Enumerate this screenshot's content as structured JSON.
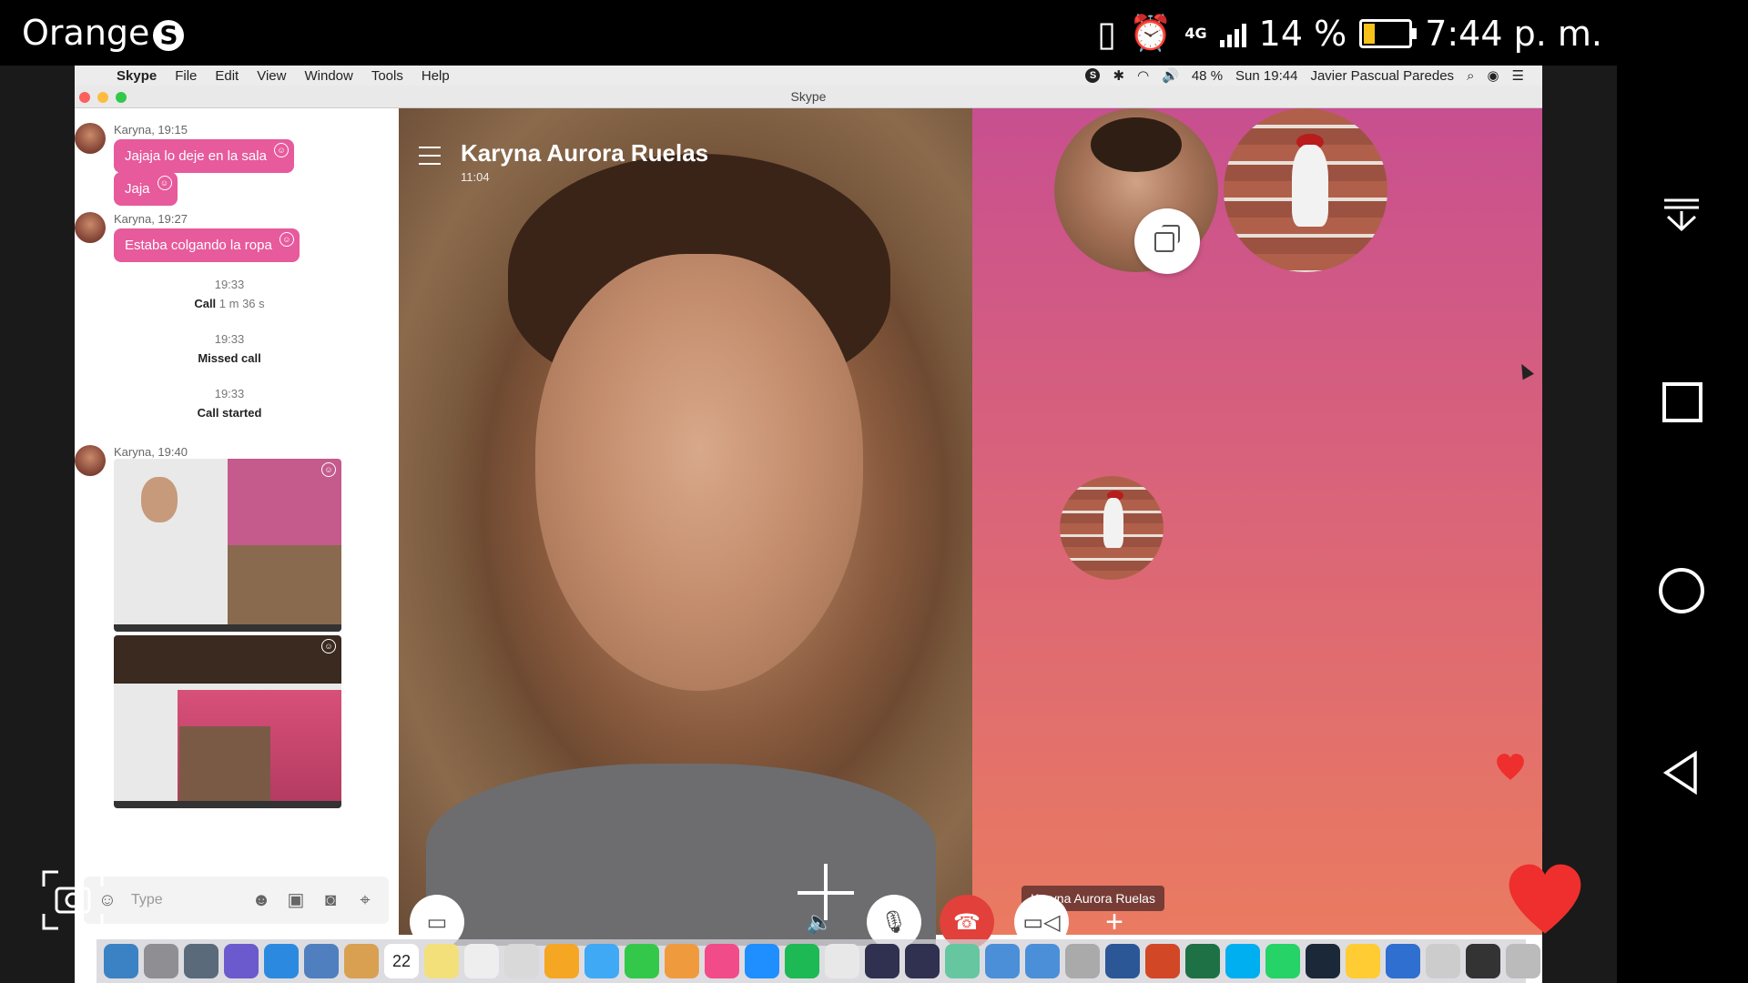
{
  "android": {
    "carrier": "Orange",
    "carrier_badge": "S",
    "network": "4G",
    "battery_pct": "14 %",
    "battery_level": 0.14,
    "time": "7:44 p. m.",
    "nav_icons": [
      "expand-down-icon",
      "recent-apps-icon",
      "home-icon",
      "back-icon"
    ]
  },
  "mac_menubar": {
    "apple_icon": "apple-icon",
    "app_name": "Skype",
    "menus": [
      "File",
      "Edit",
      "View",
      "Window",
      "Tools",
      "Help"
    ],
    "battery": "48 %",
    "clock": "Sun 19:44",
    "user": "Javier Pascual Paredes"
  },
  "window": {
    "title": "Skype"
  },
  "chat": {
    "messages": [
      {
        "sender": "Karyna, 19:15",
        "bubbles": [
          "Jajaja lo deje en la sala",
          "Jaja"
        ]
      },
      {
        "sender": "Karyna, 19:27",
        "bubbles": [
          "Estaba colgando la ropa"
        ]
      }
    ],
    "system": [
      {
        "time": "19:33",
        "label": "Call",
        "detail": "1 m 36 s"
      },
      {
        "time": "19:33",
        "label": "Missed call",
        "detail": ""
      },
      {
        "time": "19:33",
        "label": "Call started",
        "detail": ""
      }
    ],
    "media_sender": "Karyna, 19:40",
    "composer": {
      "placeholder": "Type"
    }
  },
  "call": {
    "contact_name": "Karyna Aurora Ruelas",
    "duration": "11:04",
    "peer_label": "Karyna Aurora Ruelas"
  },
  "colors": {
    "bubble": "#e75a9c",
    "end_call": "#e2403a",
    "call_bg_top": "#c84f90",
    "call_bg_bottom": "#ea7b60",
    "heart": "#ef2e2e"
  },
  "dock": {
    "icons": [
      "finder-icon",
      "system-prefs-icon",
      "launchpad-icon",
      "siri-icon",
      "safari-icon",
      "preview-icon",
      "notes-icon",
      "calendar-icon",
      "stickies-icon",
      "textedit-icon",
      "photos-app-icon",
      "photos-icon",
      "messages-icon",
      "facetime-icon",
      "books-icon",
      "itunes-icon",
      "app-store-icon",
      "spotify-icon",
      "chrome-icon",
      "window-icon",
      "window2-icon",
      "atom-icon",
      "pages-icon",
      "keynote-icon",
      "disk-utility-icon",
      "word-icon",
      "powerpoint-icon",
      "excel-icon",
      "skype-icon",
      "whatsapp-icon",
      "steam-icon",
      "pencil-icon",
      "xcode-icon",
      "finder-window-icon",
      "terminal-icon",
      "trash-icon"
    ],
    "calendar_day": "22"
  }
}
